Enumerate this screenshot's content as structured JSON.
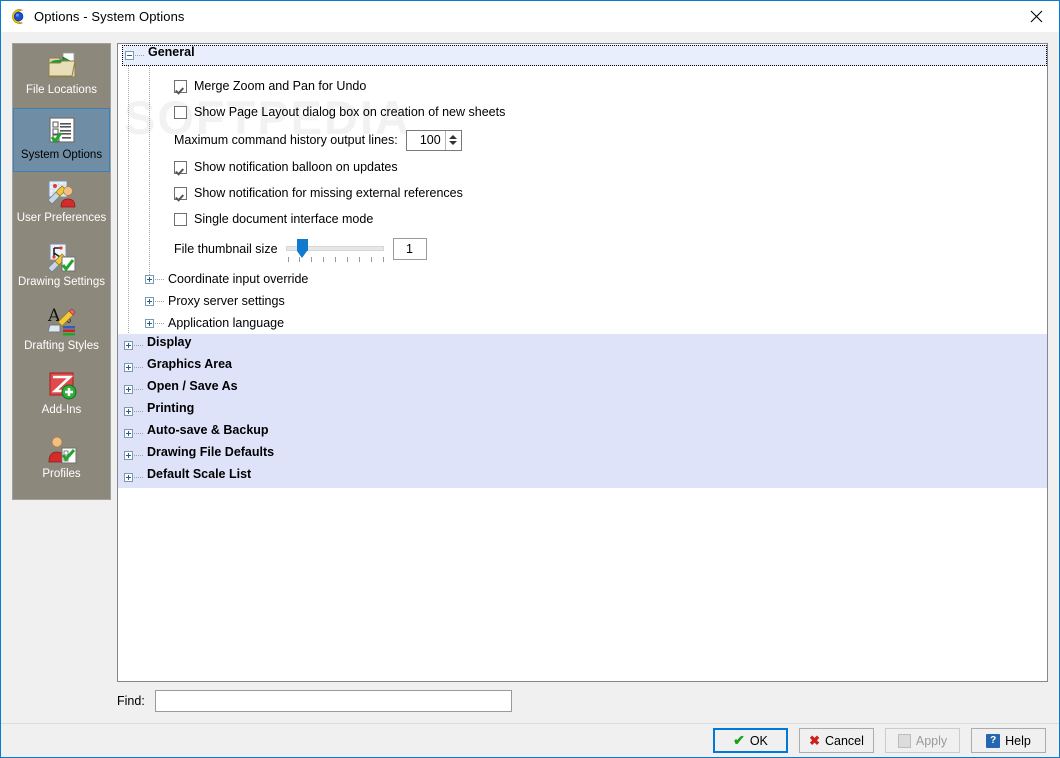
{
  "window": {
    "title": "Options - System Options",
    "icon": "app-logo-icon",
    "close_label": "✕"
  },
  "sidebar": {
    "items": [
      {
        "label": "File Locations",
        "icon": "folder-arrow-icon",
        "selected": false
      },
      {
        "label": "System Options",
        "icon": "checklist-icon",
        "selected": true
      },
      {
        "label": "User Preferences",
        "icon": "user-pencil-icon",
        "selected": false
      },
      {
        "label": "Drawing Settings",
        "icon": "drawing-pencil-icon",
        "selected": false
      },
      {
        "label": "Drafting Styles",
        "icon": "text-style-icon",
        "selected": false
      },
      {
        "label": "Add-Ins",
        "icon": "addin-plus-icon",
        "selected": false
      },
      {
        "label": "Profiles",
        "icon": "profile-user-icon",
        "selected": false
      }
    ]
  },
  "watermark": "SOFTPEDIA",
  "tree": {
    "general": {
      "label": "General",
      "expander": "minus",
      "options": [
        {
          "type": "checkbox",
          "label": "Merge Zoom and Pan for Undo",
          "checked": true
        },
        {
          "type": "checkbox",
          "label": "Show Page Layout dialog box on creation of new sheets",
          "checked": false
        },
        {
          "type": "spinner",
          "label": "Maximum command history output lines:",
          "value": "100"
        },
        {
          "type": "checkbox",
          "label": "Show notification balloon on updates",
          "checked": true
        },
        {
          "type": "checkbox",
          "label": "Show notification for missing external references",
          "checked": true
        },
        {
          "type": "checkbox",
          "label": "Single document interface mode",
          "checked": false
        },
        {
          "type": "slider",
          "label": "File thumbnail size",
          "value": "1",
          "ticks": 9,
          "thumb_index": 1
        }
      ],
      "subgroups": [
        {
          "label": "Coordinate input override",
          "expander": "plus"
        },
        {
          "label": "Proxy server settings",
          "expander": "plus"
        },
        {
          "label": "Application language",
          "expander": "plus"
        }
      ]
    },
    "groups": [
      {
        "label": "Display",
        "expander": "plus",
        "highlighted": true
      },
      {
        "label": "Graphics Area",
        "expander": "plus",
        "highlighted": true
      },
      {
        "label": "Open / Save As",
        "expander": "plus",
        "highlighted": true
      },
      {
        "label": "Printing",
        "expander": "plus",
        "highlighted": true
      },
      {
        "label": "Auto-save & Backup",
        "expander": "plus",
        "highlighted": true
      },
      {
        "label": "Drawing File Defaults",
        "expander": "plus",
        "highlighted": true
      },
      {
        "label": "Default Scale List",
        "expander": "plus",
        "highlighted": true
      }
    ]
  },
  "find": {
    "label": "Find:",
    "value": "",
    "placeholder": ""
  },
  "buttons": [
    {
      "label": "OK",
      "icon": "green-check-icon",
      "state": "focused"
    },
    {
      "label": "Cancel",
      "icon": "red-x-icon",
      "state": "normal"
    },
    {
      "label": "Apply",
      "icon": "apply-page-icon",
      "state": "disabled"
    },
    {
      "label": "Help",
      "icon": "question-mark-icon",
      "state": "normal"
    }
  ],
  "colors": {
    "accent": "#0078d7",
    "sidebar_bg": "#8c897c",
    "selected_item": "#6f8ea6",
    "group_highlight": "#dfe3fa",
    "general_header": "#e8eefb",
    "slider_blue": "#0f7bce"
  }
}
